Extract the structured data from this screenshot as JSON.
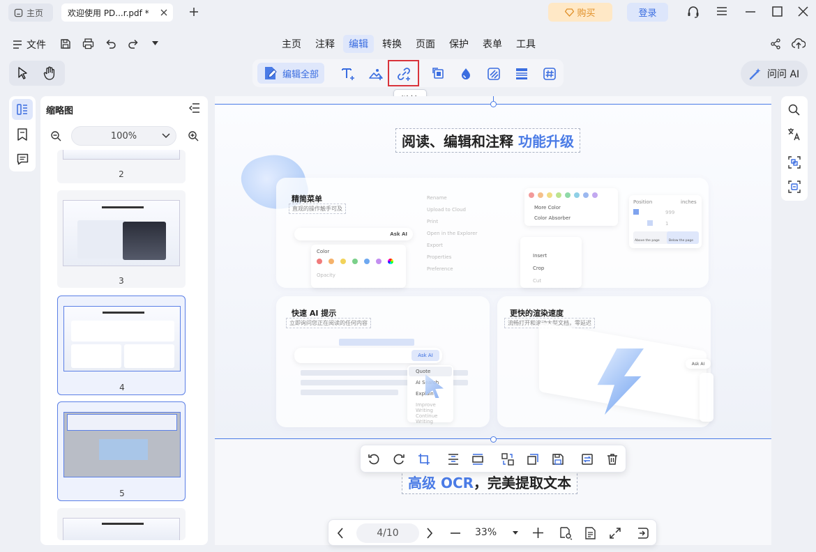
{
  "tabs": [
    {
      "label": "主页"
    },
    {
      "label": "欢迎使用 PD...r.pdf *"
    }
  ],
  "titlebar": {
    "buy_label": "购买",
    "login_label": "登录"
  },
  "menubar": {
    "file_label": "文件",
    "items": [
      "主页",
      "注释",
      "编辑",
      "转换",
      "页面",
      "保护",
      "表单",
      "工具"
    ],
    "active": "编辑"
  },
  "toolbar": {
    "edit_all_label": "编辑全部",
    "tooltip": "链接",
    "ask_ai_label": "问问 AI"
  },
  "thumbnails": {
    "title": "缩略图",
    "zoom": "100%",
    "pages": [
      "2",
      "3",
      "4",
      "5"
    ]
  },
  "document": {
    "heading_main": "阅读、编辑和注释",
    "heading_accent": "功能升级",
    "panel1": {
      "title": "精简菜单",
      "subtitle": "直观的操作触手可及",
      "color_label": "Color",
      "opacity_label": "Opacity",
      "ask_ai": "Ask AI",
      "menu_items": [
        "Rename",
        "Upload to Cloud",
        "Print",
        "Open in the Explorer",
        "Export",
        "Properties",
        "Preference"
      ],
      "more_color": "More Color",
      "color_absorber": "Color Absorber",
      "insert": "Insert",
      "crop": "Crop",
      "cut": "Cut",
      "position": "Position",
      "inches": "inches",
      "x_value": "999",
      "y_value": "1",
      "above_page": "Above the page",
      "below_page": "Below the page"
    },
    "panel2": {
      "title": "快速 AI 提示",
      "subtitle": "立即询问您正在阅读的任何内容",
      "ask_ai": "Ask AI",
      "items": [
        "Quote",
        "AI Search",
        "Explain",
        "Improve Writing",
        "Continue Writing"
      ]
    },
    "panel3": {
      "title": "更快的渲染速度",
      "subtitle": "流畅打开和滚动大型文档，零延迟",
      "ask_ai": "Ask AI"
    },
    "next_heading_accent": "高级 OCR",
    "next_heading_main": "，完美提取文本"
  },
  "bottom_nav": {
    "page": "4/10",
    "zoom": "33%"
  },
  "colors": {
    "accent": "#3a6de0",
    "highlight": "#d9333b",
    "buy": "#e0902a"
  }
}
